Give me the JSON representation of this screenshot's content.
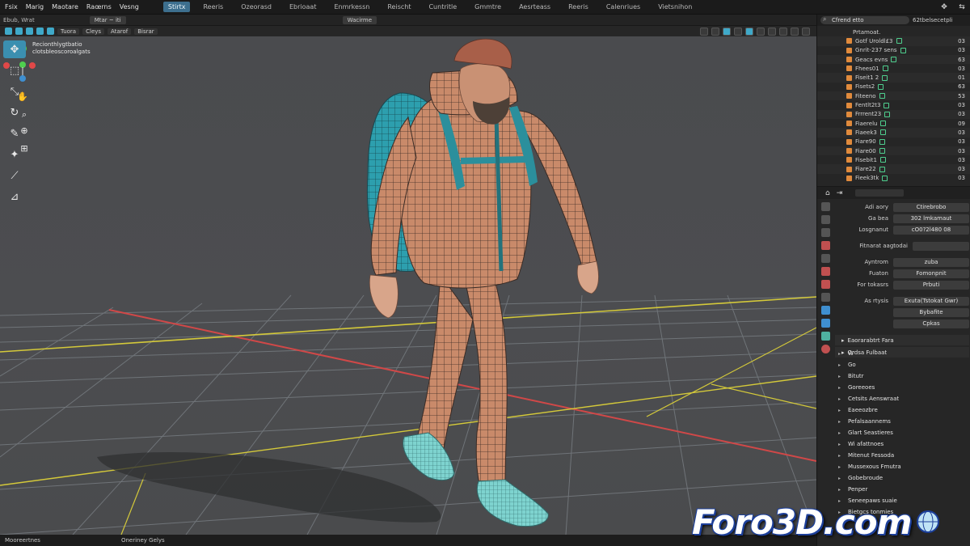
{
  "menubar": {
    "items": [
      "Fsix",
      "Marig",
      "Maotare",
      "Raœrns",
      "Vesng"
    ],
    "tabs": [
      "Stirtx",
      "Reeris",
      "Ozeorasd",
      "Ebrioaat",
      "Enmrkessn",
      "Reischt",
      "Cuntritle",
      "Gmmtre",
      "Aesrteass",
      "Reeris",
      "Calenriues",
      "Vietsnihon"
    ]
  },
  "viewport_header": {
    "left": "Ebub, Wrat",
    "dropdown": "Mtar ~ iti",
    "mode": "Wacirme"
  },
  "viewport_toolbar": {
    "labels": [
      "Tuora",
      "Cleys",
      "Atarof",
      "Bisrar"
    ]
  },
  "viewport_info": {
    "line1": "Recionthlygtbatio",
    "line2": "clotsbleoscoroalgats"
  },
  "tool_icons": [
    "move-icon",
    "select-box-icon",
    "cursor-icon",
    "rotate-icon",
    "brush-icon",
    "scale-icon",
    "annotate-icon",
    "measure-icon"
  ],
  "outliner": {
    "search_placeholder": "Cfrend etto",
    "header_label": "62tbelsecetpli",
    "root": "Prtamoat.",
    "rows": [
      {
        "name": "Gotf Uroldl£3",
        "num": "03"
      },
      {
        "name": "Gnrit-237 sens",
        "num": "03"
      },
      {
        "name": "Geacs evns",
        "num": "63"
      },
      {
        "name": "Fhees01",
        "num": "03"
      },
      {
        "name": "Fiseit1 2",
        "num": "01"
      },
      {
        "name": "Fisets2",
        "num": "63"
      },
      {
        "name": "Fiteeno",
        "num": "53"
      },
      {
        "name": "Fentlt2t3",
        "num": "03"
      },
      {
        "name": "Frrrent23",
        "num": "03"
      },
      {
        "name": "Fiaerelu",
        "num": "09"
      },
      {
        "name": "Fiaeek3",
        "num": "03"
      },
      {
        "name": "Fiare90",
        "num": "03"
      },
      {
        "name": "Fiare00",
        "num": "03"
      },
      {
        "name": "Fisebit1",
        "num": "03"
      },
      {
        "name": "Fiare22",
        "num": "03"
      },
      {
        "name": "Fieek3tk",
        "num": "03"
      }
    ]
  },
  "properties": {
    "rows_a": [
      {
        "k": "Adi aory",
        "v": "Ctirebrobo"
      },
      {
        "k": "Ga bea",
        "v": "302 lmkamaut"
      },
      {
        "k": "Losgnanut",
        "v": "cO0?2l480 08"
      }
    ],
    "row_b": {
      "k": "Fitnarat aagtodai",
      "v": ""
    },
    "rows_c": [
      {
        "k": "Ayntrom",
        "v": "zuba"
      },
      {
        "k": "Fuaton",
        "v": "Fomonpnit"
      },
      {
        "k": "For tokasrs",
        "v": "Prbuti"
      }
    ],
    "rows_d": [
      {
        "k": "As rtysis",
        "v": "Exuta(Tstokat Gwr)"
      },
      {
        "k": "",
        "v": "Bybafite"
      },
      {
        "k": "",
        "v": "Cpkas"
      }
    ],
    "sections": [
      "Eaorarabtrt Fara",
      "Ordsa Fulbaat"
    ]
  },
  "tree": [
    "W",
    "Go",
    "Bitutr",
    "Goreeoes",
    "Cetsits Aenswraat",
    "Eaeeozbre",
    "Pefalsaannems",
    "Glart Seastieres",
    "Wi afattnoes",
    "Mitenut Fessoda",
    "Mussexous Fmutra",
    "Gobebroude",
    "Penper",
    "Seneepaws suaie",
    "Bietgcs tonmies"
  ],
  "status": {
    "left": "Mooreertnes",
    "middle": "Oneriney Gelys"
  },
  "watermark": "Foro3D.com",
  "colors": {
    "accent": "#3fa9c9",
    "grid": "#6e7377",
    "x_axis": "#d04848",
    "y_axis": "#d4c93a"
  }
}
